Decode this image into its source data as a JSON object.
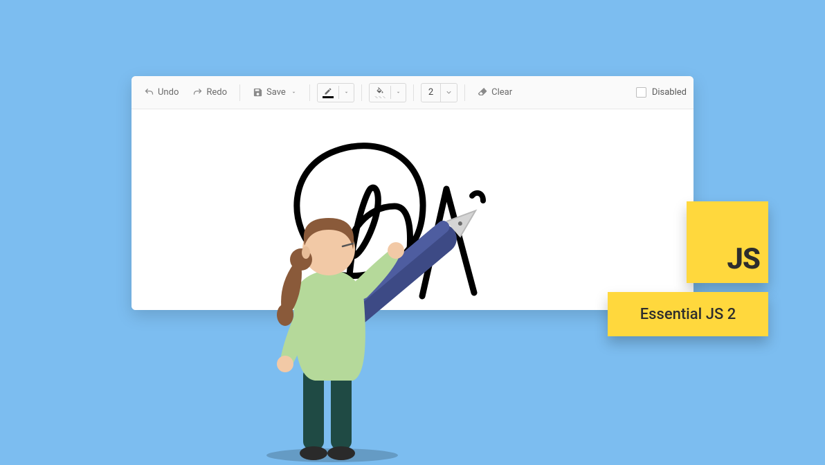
{
  "toolbar": {
    "undo_label": "Undo",
    "redo_label": "Redo",
    "save_label": "Save",
    "clear_label": "Clear",
    "stroke_width_value": "2",
    "disabled_label": "Disabled"
  },
  "badges": {
    "js": "JS",
    "essential": "Essential JS 2"
  },
  "colors": {
    "background": "#7cbdf0",
    "badge": "#ffd83d",
    "pen_stroke": "#000000"
  }
}
